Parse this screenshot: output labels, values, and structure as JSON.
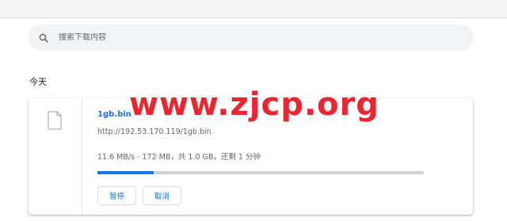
{
  "search": {
    "placeholder": "搜索下载内容",
    "icon": "search-icon"
  },
  "downloads": {
    "date_heading": "今天",
    "items": [
      {
        "file_name": "1gb.bin",
        "url": "http://192.53.170.119/1gb.bin",
        "status": "11.6 MB/s - 172 MB，共 1.0 GB，还剩 1 分钟",
        "progress": 0.172,
        "pause_label": "暂停",
        "cancel_label": "取消",
        "icon": "file-icon"
      }
    ]
  },
  "watermark": "www.zjcp.org",
  "colors": {
    "accent": "#1a73e8",
    "watermark": "#f0242e"
  }
}
